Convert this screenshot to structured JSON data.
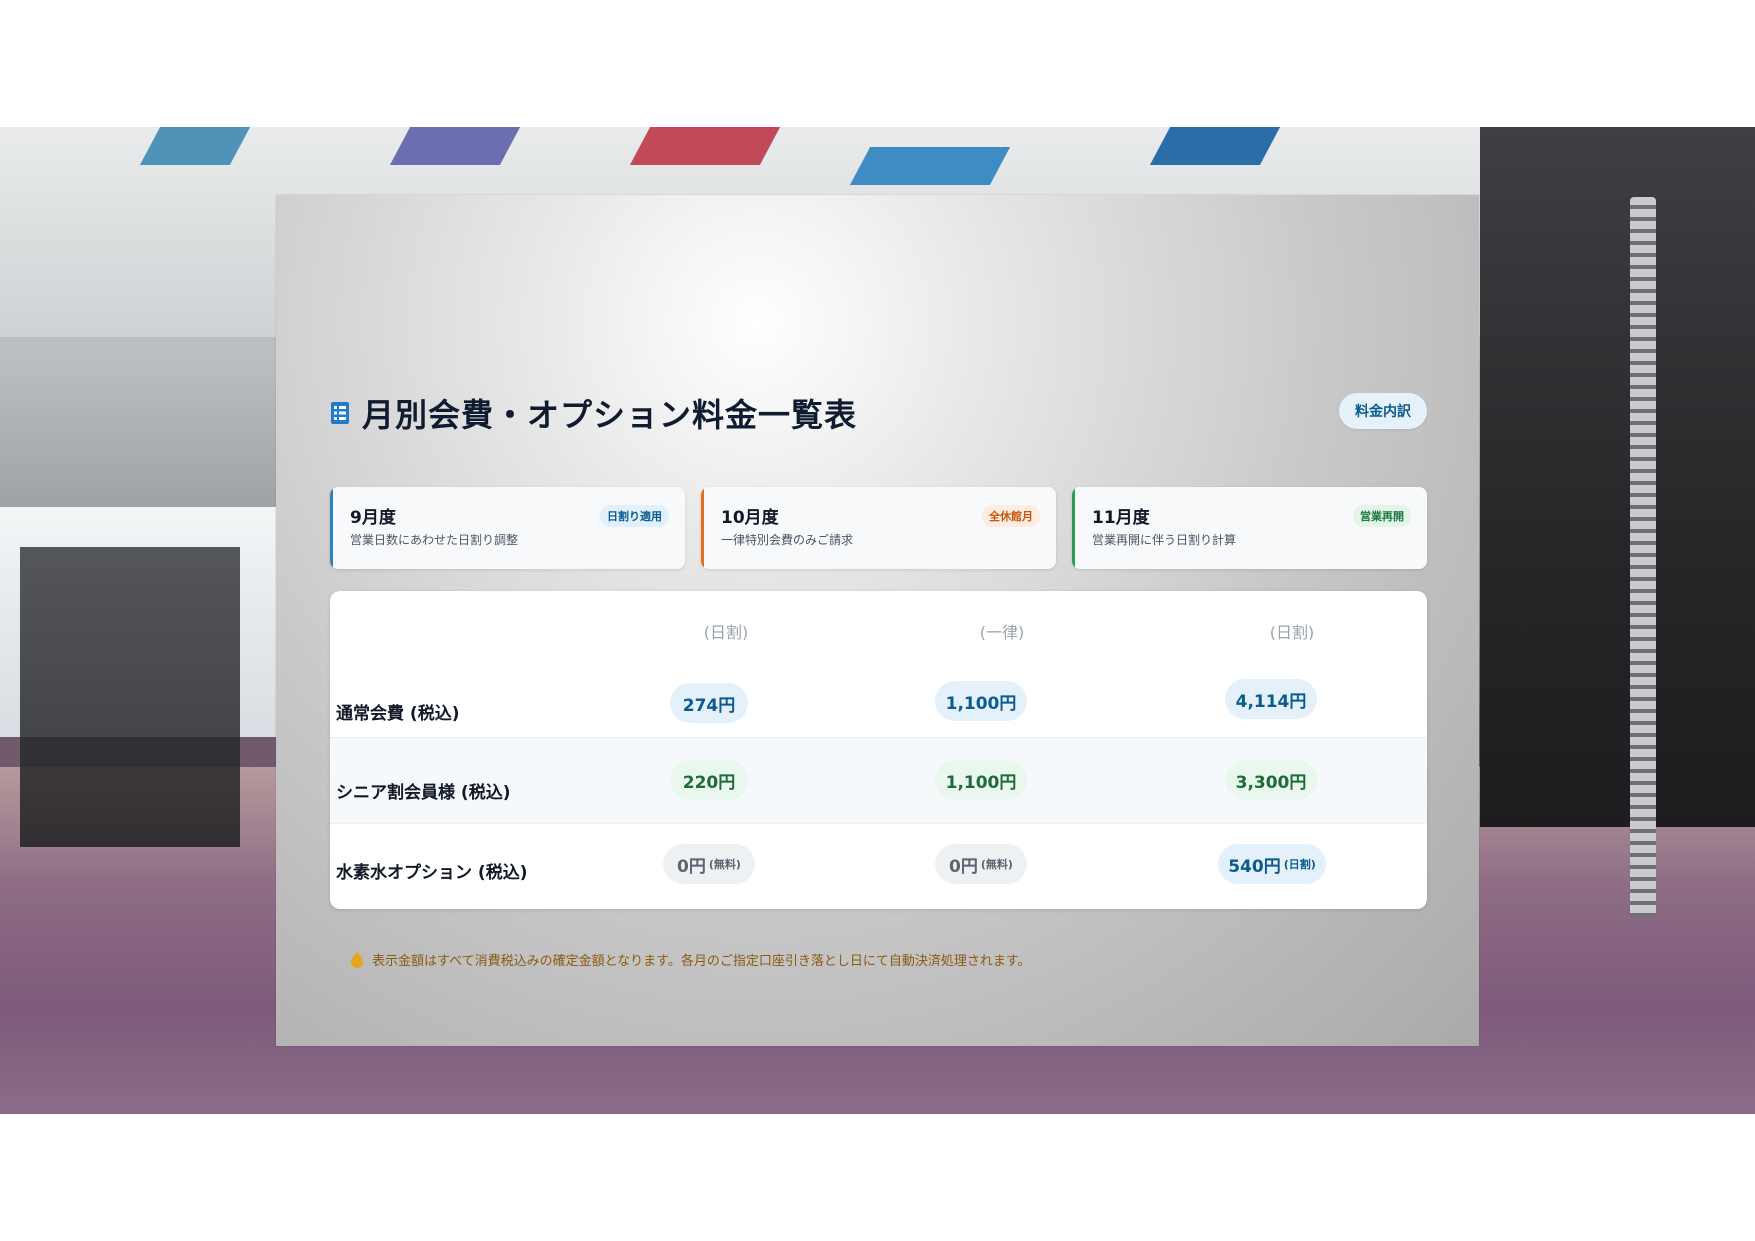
{
  "header": {
    "title": "月別会費・オプション料金一覧表",
    "badge": "料金内訳",
    "title_icon": "list-icon"
  },
  "months": [
    {
      "name": "9月度",
      "desc": "営業日数にあわせた日割り調整",
      "tag": "日割り適用",
      "accent": "#2b83c4",
      "tag_bg": "#e2f0fb",
      "tag_color": "#0c5b8e"
    },
    {
      "name": "10月度",
      "desc": "一律特別会費のみご請求",
      "tag": "全休館月",
      "accent": "#e0701c",
      "tag_bg": "#fdece0",
      "tag_color": "#c4570f"
    },
    {
      "name": "11月度",
      "desc": "営業再開に伴う日割り計算",
      "tag": "営業再開",
      "accent": "#2f9b55",
      "tag_bg": "#e3f5e9",
      "tag_color": "#1e7a40"
    }
  ],
  "table": {
    "col_heads": [
      "(日割)",
      "(一律)",
      "(日割)"
    ],
    "rows": [
      {
        "label": "通常会費 (税込)",
        "cells": [
          {
            "value": "274円",
            "sub": "",
            "style": "blue"
          },
          {
            "value": "1,100円",
            "sub": "",
            "style": "blue"
          },
          {
            "value": "4,114円",
            "sub": "",
            "style": "blue"
          }
        ]
      },
      {
        "label": "シニア割会員様 (税込)",
        "cells": [
          {
            "value": "220円",
            "sub": "",
            "style": "green"
          },
          {
            "value": "1,100円",
            "sub": "",
            "style": "green"
          },
          {
            "value": "3,300円",
            "sub": "",
            "style": "green"
          }
        ]
      },
      {
        "label": "水素水オプション (税込)",
        "cells": [
          {
            "value": "0円",
            "sub": "(無料)",
            "style": "gray"
          },
          {
            "value": "0円",
            "sub": "(無料)",
            "style": "gray"
          },
          {
            "value": "540円",
            "sub": "(日割)",
            "style": "blue"
          }
        ]
      }
    ]
  },
  "note": {
    "text": "表示金額はすべて消費税込みの確定金額となります。各月のご指定口座引き落とし日にて自動決済処理されます。",
    "icon": "info-drop-icon",
    "color": "#8a5a12"
  }
}
